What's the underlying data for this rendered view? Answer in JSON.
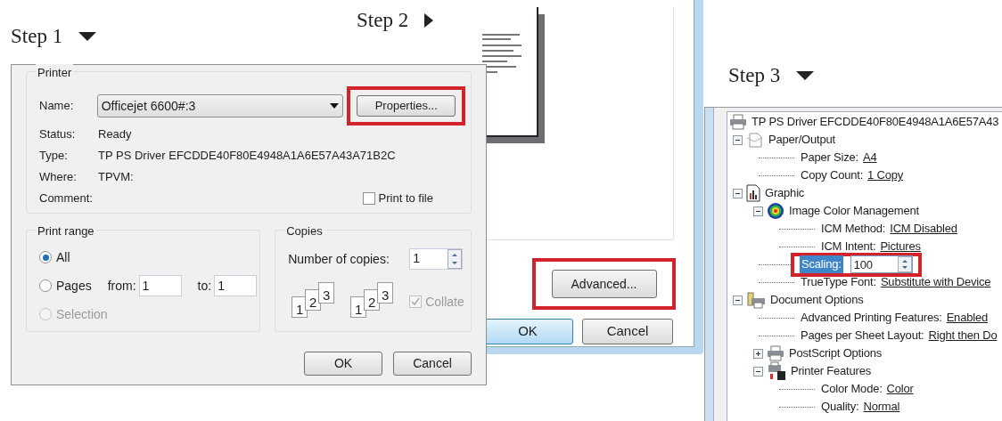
{
  "steps": [
    {
      "label": "Step 1",
      "kind": "down"
    },
    {
      "label": "Step 2",
      "kind": "right"
    },
    {
      "label": "Step 3",
      "kind": "down"
    }
  ],
  "print_dialog": {
    "printer_group": {
      "title": "Printer",
      "name_label": "Name:",
      "name_value": "Officejet 6600#:3",
      "properties_button": {
        "label": "Properties...",
        "highlighted": true
      },
      "fields": [
        {
          "label": "Status:",
          "value": "Ready"
        },
        {
          "label": "Type:",
          "value": "TP PS Driver EFCDDE40F80E4948A1A6E57A43A71B2C"
        },
        {
          "label": "Where:",
          "value": "TPVM:"
        },
        {
          "label": "Comment:"
        }
      ],
      "print_to_file": {
        "label": "Print to file",
        "checked": false
      }
    },
    "range_group": {
      "title": "Print range",
      "options": [
        {
          "label": "All",
          "selected": true,
          "disabled": false
        },
        {
          "label": "Pages",
          "selected": false,
          "disabled": false
        },
        {
          "label": "Selection",
          "selected": false,
          "disabled": true
        }
      ],
      "from_label": "from:",
      "from_value": "1",
      "to_label": "to:",
      "to_value": "1"
    },
    "copies_group": {
      "title": "Copies",
      "copies_label": "Number of copies:",
      "copies_value": "1",
      "collate_pages": [
        [
          "1",
          "2",
          "3"
        ],
        [
          "1",
          "2",
          "3"
        ]
      ],
      "collate": {
        "label": "Collate",
        "checked": true,
        "disabled": true
      }
    },
    "buttons": [
      {
        "label": "OK",
        "default": false
      },
      {
        "label": "Cancel",
        "default": false
      }
    ]
  },
  "preferences_dialog": {
    "advanced_button": {
      "label": "Advanced...",
      "highlighted": true
    },
    "buttons": [
      {
        "label": "OK",
        "default": true
      },
      {
        "label": "Cancel",
        "default": false
      }
    ]
  },
  "advanced_tree": {
    "kind": "printer",
    "label": "TP PS Driver EFCDDE40F80E4948A1A6E57A43",
    "selected": false,
    "children": [
      {
        "kind": "paper",
        "label": "Paper/Output",
        "expanded": true,
        "selected": false,
        "children": [
          {
            "kind": "setting",
            "label": "Paper Size:",
            "value": "A4",
            "selected": false
          },
          {
            "kind": "setting",
            "label": "Copy Count:",
            "value": "1 Copy",
            "selected": false
          }
        ]
      },
      {
        "kind": "graphic",
        "label": "Graphic",
        "expanded": true,
        "selected": false,
        "children": [
          {
            "kind": "color",
            "label": "Image Color Management",
            "expanded": true,
            "selected": false,
            "children": [
              {
                "kind": "setting",
                "label": "ICM Method:",
                "value": "ICM Disabled",
                "selected": false
              },
              {
                "kind": "setting",
                "label": "ICM Intent:",
                "value": "Pictures",
                "selected": false
              }
            ]
          },
          {
            "kind": "spin",
            "label": "Scaling:",
            "value": "100",
            "selected": true,
            "highlighted": true
          },
          {
            "kind": "setting",
            "label": "TrueType Font:",
            "value": "Substitute with Device",
            "selected": false
          }
        ]
      },
      {
        "kind": "options",
        "label": "Document Options",
        "expanded": true,
        "selected": false,
        "children": [
          {
            "kind": "setting",
            "label": "Advanced Printing Features:",
            "value": "Enabled",
            "selected": false
          },
          {
            "kind": "setting",
            "label": "Pages per Sheet Layout:",
            "value": "Right then Do",
            "selected": false
          },
          {
            "kind": "printer",
            "label": "PostScript Options",
            "expanded": false,
            "selected": false
          },
          {
            "kind": "features",
            "label": "Printer Features",
            "expanded": true,
            "selected": false,
            "children": [
              {
                "kind": "setting",
                "label": "Color Mode:",
                "value": "Color",
                "selected": false
              },
              {
                "kind": "setting",
                "label": "Quality:",
                "value": "Normal",
                "selected": false
              }
            ]
          }
        ]
      }
    ]
  }
}
